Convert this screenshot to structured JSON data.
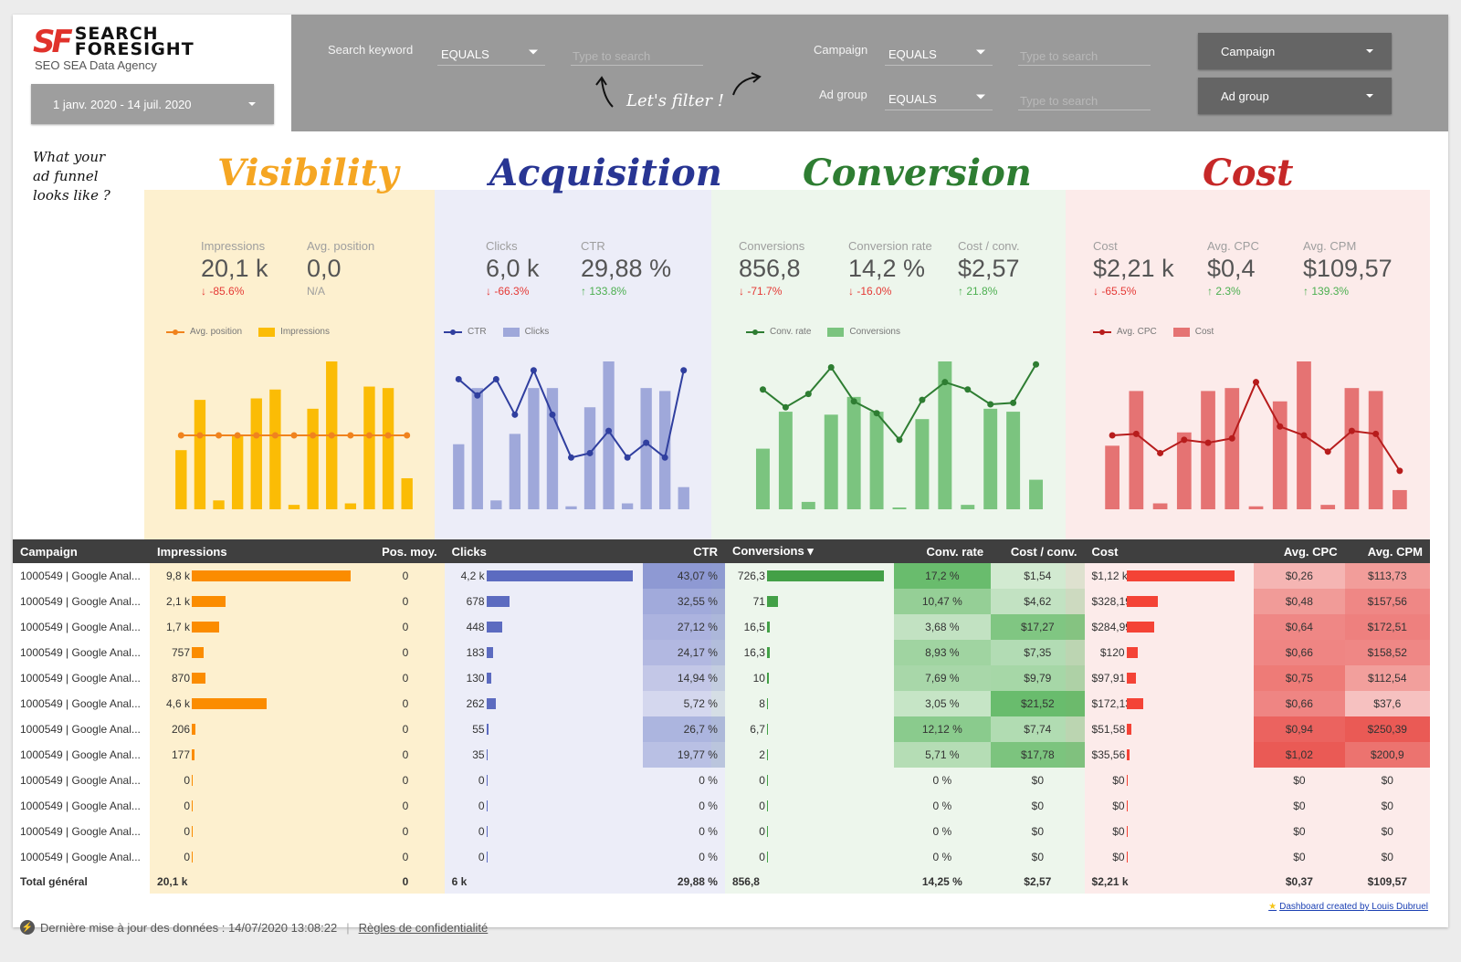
{
  "brand": {
    "logo_mark": "SF",
    "name_line1": "SEARCH",
    "name_line2": "FORESIGHT",
    "tagline": "SEO SEA Data Agency"
  },
  "date_range": "1 janv. 2020 - 14 juil. 2020",
  "filters": {
    "keyword": {
      "label": "Search keyword",
      "operator": "EQUALS",
      "placeholder": "Type to search"
    },
    "campaign": {
      "label": "Campaign",
      "operator": "EQUALS",
      "placeholder": "Type to search"
    },
    "adgroup": {
      "label": "Ad group",
      "operator": "EQUALS",
      "placeholder": "Type to search"
    },
    "campaign_dropdown": "Campaign",
    "adgroup_dropdown": "Ad group",
    "annotation": "Let's filter !"
  },
  "side_note": [
    "What your",
    "ad funnel",
    "looks like ?"
  ],
  "colors": {
    "visibility_bg": "#fdf0cf",
    "visibility_title": "#f5a623",
    "visibility_bar": "#fbbc05",
    "visibility_line": "#f0831e",
    "acquisition_bg": "#ecedf8",
    "acquisition_title": "#283593",
    "acquisition_bar": "#9fa8da",
    "acquisition_line": "#303f9f",
    "conversion_bg": "#edf6ec",
    "conversion_title": "#2e7d32",
    "conversion_bar": "#7bc47f",
    "conversion_line": "#2e7d32",
    "cost_bg": "#fcebea",
    "cost_title": "#c62828",
    "cost_bar": "#e57373",
    "cost_line": "#b71c1c"
  },
  "sections": [
    {
      "key": "visibility",
      "title": "Visibility",
      "kpis": [
        {
          "label": "Impressions",
          "value": "20,1 k",
          "delta": "-85.6%",
          "dir": "down"
        },
        {
          "label": "Avg. position",
          "value": "0,0",
          "delta": "N/A",
          "dir": "na"
        }
      ],
      "legend": {
        "line": "Avg. position",
        "bar": "Impressions"
      }
    },
    {
      "key": "acquisition",
      "title": "Acquisition",
      "kpis": [
        {
          "label": "Clicks",
          "value": "6,0 k",
          "delta": "-66.3%",
          "dir": "down"
        },
        {
          "label": "CTR",
          "value": "29,88 %",
          "delta": "133.8%",
          "dir": "up"
        }
      ],
      "legend": {
        "line": "CTR",
        "bar": "Clicks"
      }
    },
    {
      "key": "conversion",
      "title": "Conversion",
      "kpis": [
        {
          "label": "Conversions",
          "value": "856,8",
          "delta": "-71.7%",
          "dir": "down"
        },
        {
          "label": "Conversion rate",
          "value": "14,2 %",
          "delta": "-16.0%",
          "dir": "down"
        },
        {
          "label": "Cost / conv.",
          "value": "$2,57",
          "delta": "21.8%",
          "dir": "up"
        }
      ],
      "legend": {
        "line": "Conv. rate",
        "bar": "Conversions"
      }
    },
    {
      "key": "cost",
      "title": "Cost",
      "kpis": [
        {
          "label": "Cost",
          "value": "$2,21 k",
          "delta": "-65.5%",
          "dir": "down"
        },
        {
          "label": "Avg. CPC",
          "value": "$0,4",
          "delta": "2.3%",
          "dir": "up"
        },
        {
          "label": "Avg. CPM",
          "value": "$109,57",
          "delta": "139.3%",
          "dir": "up"
        }
      ],
      "legend": {
        "line": "Avg. CPC",
        "bar": "Cost"
      }
    }
  ],
  "chart_data": [
    {
      "type": "bar",
      "title": "Visibility",
      "series": [
        {
          "name": "Impressions",
          "kind": "bar",
          "values": [
            40,
            74,
            6,
            50,
            75,
            81,
            3,
            68,
            100,
            4,
            83,
            82,
            21
          ]
        },
        {
          "name": "Avg. position",
          "kind": "line",
          "values": [
            50,
            50,
            50,
            50,
            50,
            50,
            50,
            50,
            50,
            50,
            50,
            50,
            50
          ]
        }
      ]
    },
    {
      "type": "bar",
      "title": "Acquisition",
      "series": [
        {
          "name": "Clicks",
          "kind": "bar",
          "values": [
            44,
            82,
            6,
            51,
            82,
            82,
            2,
            69,
            100,
            4,
            82,
            80,
            15
          ]
        },
        {
          "name": "CTR",
          "kind": "line",
          "values": [
            88,
            77,
            88,
            64,
            94,
            64,
            35,
            38,
            53,
            35,
            45,
            35,
            94
          ]
        }
      ]
    },
    {
      "type": "bar",
      "title": "Conversion",
      "series": [
        {
          "name": "Conversions",
          "kind": "bar",
          "values": [
            41,
            66,
            5,
            64,
            76,
            66,
            1,
            61,
            100,
            3,
            68,
            66,
            20
          ]
        },
        {
          "name": "Conv. rate",
          "kind": "line",
          "values": [
            81,
            69,
            78,
            96,
            73,
            65,
            47,
            74,
            86,
            81,
            71,
            72,
            98
          ]
        }
      ]
    },
    {
      "type": "bar",
      "title": "Cost",
      "series": [
        {
          "name": "Cost",
          "kind": "bar",
          "values": [
            43,
            80,
            4,
            52,
            80,
            82,
            2,
            73,
            100,
            3,
            82,
            80,
            13
          ]
        },
        {
          "name": "Avg. CPC",
          "kind": "line",
          "values": [
            50,
            51,
            38,
            47,
            45,
            48,
            86,
            56,
            50,
            39,
            53,
            51,
            26
          ]
        }
      ]
    }
  ],
  "table": {
    "headers": [
      "Campaign",
      "Impressions",
      "Pos. moy.",
      "Clicks",
      "CTR",
      "Conversions ▾",
      "Conv. rate",
      "Cost / conv.",
      "Cost",
      "Avg. CPC",
      "Avg. CPM"
    ],
    "rows": [
      {
        "campaign": "1000549 | Google Anal...",
        "impr": "9,8 k",
        "impr_v": 9800,
        "pos": "0",
        "clicks": "4,2 k",
        "clicks_v": 4200,
        "ctr": "43,07 %",
        "conv": "726,3",
        "conv_v": 726.3,
        "cr": "17,2 %",
        "cpconv": "$1,54",
        "cost": "$1,12 k",
        "cost_v": 1120,
        "cpc": "$0,26",
        "cpm": "$113,73"
      },
      {
        "campaign": "1000549 | Google Anal...",
        "impr": "2,1 k",
        "impr_v": 2100,
        "pos": "0",
        "clicks": "678",
        "clicks_v": 678,
        "ctr": "32,55 %",
        "conv": "71",
        "conv_v": 71,
        "cr": "10,47 %",
        "cpconv": "$4,62",
        "cost": "$328,19",
        "cost_v": 328.19,
        "cpc": "$0,48",
        "cpm": "$157,56"
      },
      {
        "campaign": "1000549 | Google Anal...",
        "impr": "1,7 k",
        "impr_v": 1700,
        "pos": "0",
        "clicks": "448",
        "clicks_v": 448,
        "ctr": "27,12 %",
        "conv": "16,5",
        "conv_v": 16.5,
        "cr": "3,68 %",
        "cpconv": "$17,27",
        "cost": "$284,99",
        "cost_v": 284.99,
        "cpc": "$0,64",
        "cpm": "$172,51"
      },
      {
        "campaign": "1000549 | Google Anal...",
        "impr": "757",
        "impr_v": 757,
        "pos": "0",
        "clicks": "183",
        "clicks_v": 183,
        "ctr": "24,17 %",
        "conv": "16,3",
        "conv_v": 16.3,
        "cr": "8,93 %",
        "cpconv": "$7,35",
        "cost": "$120",
        "cost_v": 120,
        "cpc": "$0,66",
        "cpm": "$158,52"
      },
      {
        "campaign": "1000549 | Google Anal...",
        "impr": "870",
        "impr_v": 870,
        "pos": "0",
        "clicks": "130",
        "clicks_v": 130,
        "ctr": "14,94 %",
        "conv": "10",
        "conv_v": 10,
        "cr": "7,69 %",
        "cpconv": "$9,79",
        "cost": "$97,91",
        "cost_v": 97.91,
        "cpc": "$0,75",
        "cpm": "$112,54"
      },
      {
        "campaign": "1000549 | Google Anal...",
        "impr": "4,6 k",
        "impr_v": 4600,
        "pos": "0",
        "clicks": "262",
        "clicks_v": 262,
        "ctr": "5,72 %",
        "conv": "8",
        "conv_v": 8,
        "cr": "3,05 %",
        "cpconv": "$21,52",
        "cost": "$172,13",
        "cost_v": 172.13,
        "cpc": "$0,66",
        "cpm": "$37,6"
      },
      {
        "campaign": "1000549 | Google Anal...",
        "impr": "206",
        "impr_v": 206,
        "pos": "0",
        "clicks": "55",
        "clicks_v": 55,
        "ctr": "26,7 %",
        "conv": "6,7",
        "conv_v": 6.7,
        "cr": "12,12 %",
        "cpconv": "$7,74",
        "cost": "$51,58",
        "cost_v": 51.58,
        "cpc": "$0,94",
        "cpm": "$250,39"
      },
      {
        "campaign": "1000549 | Google Anal...",
        "impr": "177",
        "impr_v": 177,
        "pos": "0",
        "clicks": "35",
        "clicks_v": 35,
        "ctr": "19,77 %",
        "conv": "2",
        "conv_v": 2,
        "cr": "5,71 %",
        "cpconv": "$17,78",
        "cost": "$35,56",
        "cost_v": 35.56,
        "cpc": "$1,02",
        "cpm": "$200,9"
      },
      {
        "campaign": "1000549 | Google Anal...",
        "impr": "0",
        "impr_v": 0,
        "pos": "0",
        "clicks": "0",
        "clicks_v": 0,
        "ctr": "0 %",
        "conv": "0",
        "conv_v": 0,
        "cr": "0 %",
        "cpconv": "$0",
        "cost": "$0",
        "cost_v": 0,
        "cpc": "$0",
        "cpm": "$0"
      },
      {
        "campaign": "1000549 | Google Anal...",
        "impr": "0",
        "impr_v": 0,
        "pos": "0",
        "clicks": "0",
        "clicks_v": 0,
        "ctr": "0 %",
        "conv": "0",
        "conv_v": 0,
        "cr": "0 %",
        "cpconv": "$0",
        "cost": "$0",
        "cost_v": 0,
        "cpc": "$0",
        "cpm": "$0"
      },
      {
        "campaign": "1000549 | Google Anal...",
        "impr": "0",
        "impr_v": 0,
        "pos": "0",
        "clicks": "0",
        "clicks_v": 0,
        "ctr": "0 %",
        "conv": "0",
        "conv_v": 0,
        "cr": "0 %",
        "cpconv": "$0",
        "cost": "$0",
        "cost_v": 0,
        "cpc": "$0",
        "cpm": "$0"
      },
      {
        "campaign": "1000549 | Google Anal...",
        "impr": "0",
        "impr_v": 0,
        "pos": "0",
        "clicks": "0",
        "clicks_v": 0,
        "ctr": "0 %",
        "conv": "0",
        "conv_v": 0,
        "cr": "0 %",
        "cpconv": "$0",
        "cost": "$0",
        "cost_v": 0,
        "cpc": "$0",
        "cpm": "$0"
      }
    ],
    "total": {
      "label": "Total général",
      "impr": "20,1 k",
      "pos": "0",
      "clicks": "6 k",
      "ctr": "29,88 %",
      "conv": "856,8",
      "cr": "14,25 %",
      "cpconv": "$2,57",
      "cost": "$2,21 k",
      "cpc": "$0,37",
      "cpm": "$109,57"
    }
  },
  "credit": "Dashboard created by Louis Dubruel",
  "footer": {
    "last_update": "Dernière mise à jour des données : 14/07/2020 13:08:22",
    "privacy": "Règles de confidentialité"
  }
}
